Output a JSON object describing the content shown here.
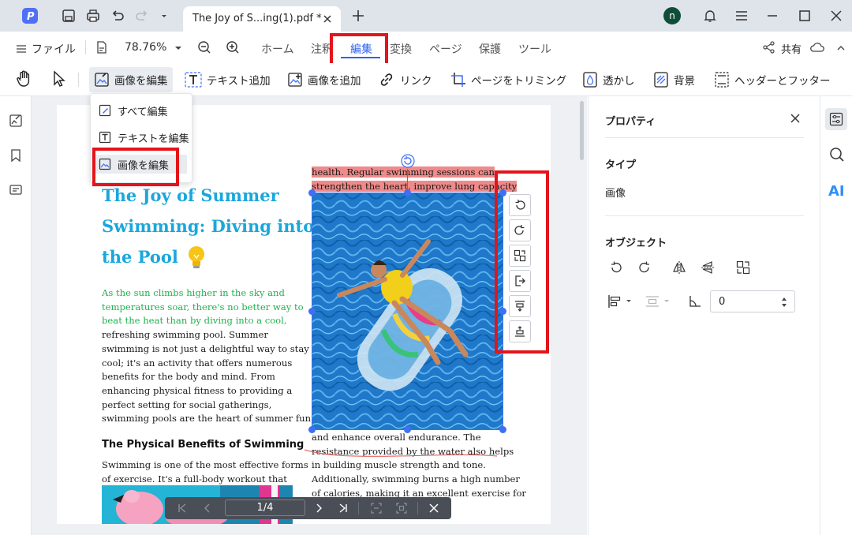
{
  "app": {
    "tab_title": "The Joy of S...ing(1).pdf *",
    "avatar_letter": "n"
  },
  "menubar": {
    "file_label": "ファイル",
    "zoom_value": "78.76%",
    "tabs": [
      "ホーム",
      "注釈",
      "編集",
      "変換",
      "ページ",
      "保護",
      "ツール"
    ],
    "active_tab": "編集",
    "share_label": "共有"
  },
  "toolbar": {
    "edit_image": "画像を編集",
    "add_text": "テキスト追加",
    "add_image": "画像を追加",
    "link": "リンク",
    "crop_page": "ページをトリミング",
    "watermark": "透かし",
    "background": "背景",
    "header_footer": "ヘッダーとフッター"
  },
  "dropdown": {
    "items": [
      "すべて編集",
      "テキストを編集",
      "画像を編集"
    ]
  },
  "document": {
    "title_lines": [
      "The Joy of Summer",
      "Swimming: Diving into",
      "the Pool"
    ],
    "intro_lines": [
      "As the sun climbs higher in the sky and",
      "temperatures soar, there's no better way to",
      "beat the heat than by diving into a cool,",
      "refreshing swimming pool. Summer",
      "swimming is not just a delightful way to stay",
      "cool; it's an activity that offers numerous",
      "benefits for the body and mind. From",
      "enhancing physical fitness to providing a",
      "perfect setting for social gatherings,",
      "swimming pools are the heart of summer fun."
    ],
    "subheading": "The Physical Benefits of Swimming",
    "section_lines": [
      "Swimming is one of the most effective forms",
      "of exercise. It's a full-body workout that"
    ],
    "right_top_lines": [
      "health. Regular swimming sessions can",
      "strengthen the heart, improve lung capacity"
    ],
    "right_bottom_lines": [
      "and enhance overall endurance. The",
      "resistance provided by the water also helps",
      "in building muscle strength and tone.",
      "Additionally, swimming burns a high number",
      "of calories, making it an excellent exercise for"
    ]
  },
  "pager": {
    "page_indicator": "1/4"
  },
  "properties": {
    "title": "プロパティ",
    "type_label": "タイプ",
    "type_value": "画像",
    "object_label": "オブジェクト",
    "opacity_value": "0"
  },
  "colors": {
    "accent": "#3f6ff5",
    "highlight_red": "#e4141b",
    "title_blue": "#1aa7dc",
    "intro_green": "#1db34c"
  }
}
